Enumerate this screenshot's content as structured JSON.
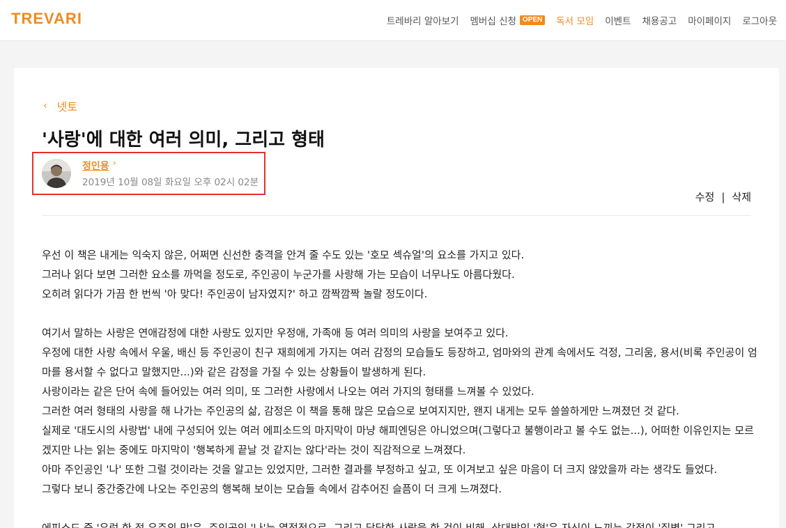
{
  "header": {
    "logo": "TREVARI",
    "nav": [
      {
        "label": "트레바리 알아보기"
      },
      {
        "label": "멤버십 신청",
        "badge": "OPEN"
      },
      {
        "label": "독서 모임",
        "active": true
      },
      {
        "label": "이벤트"
      },
      {
        "label": "채용공고"
      },
      {
        "label": "마이페이지"
      },
      {
        "label": "로그아웃"
      }
    ]
  },
  "post": {
    "back_label": "넷토",
    "title": "'사랑'에 대한 여러 의미, 그리고 형태",
    "author": "정인용",
    "date": "2019년 10월 08일 화요일 오후 02시 02분",
    "edit_label": "수정",
    "separator": "|",
    "delete_label": "삭제",
    "body": [
      "우선 이 책은 내게는 익숙지 않은, 어쩌면 신선한 충격을 안겨 줄 수도 있는 '호모 섹슈얼'의 요소를 가지고 있다.",
      "그러나 읽다 보면 그러한 요소를 까먹을 정도로, 주인공이 누군가를 사랑해 가는 모습이 너무나도 아름다웠다.",
      "오히려 읽다가 가끔 한 번씩 '아 맞다! 주인공이 남자였지?' 하고 깜짝깜짝 놀랄 정도이다.",
      "",
      "여기서 말하는 사랑은 연애감정에 대한 사랑도 있지만 우정애, 가족애 등 여러 의미의 사랑을 보여주고 있다.",
      "우정에 대한 사랑 속에서 우울, 배신 등 주인공이 친구 재희에게 가지는 여러 감정의 모습들도 등장하고, 엄마와의 관계 속에서도 걱정, 그리움, 용서(비록 주인공이 엄마를 용서할 수 없다고 말했지만...)와 같은 감정을 가질 수 있는 상황들이 발생하게 된다.",
      "사랑이라는 같은 단어 속에 들어있는 여러 의미, 또 그러한 사랑에서 나오는 여러 가지의 형태를 느껴볼 수 있었다.",
      "그러한 여러 형태의 사랑을 해 나가는 주인공의 삶, 감정은 이 책을 통해 많은 모습으로 보여지지만, 왠지 내게는 모두 쓸쓸하게만 느껴졌던 것 같다.",
      "실제로 '대도시의 사랑법' 내에 구성되어 있는 여러 에피소드의 마지막이 마냥 해피엔딩은 아니었으며(그렇다고 불행이라고 볼 수도 없는...), 어떠한 이유인지는 모르겠지만 나는 읽는 중에도 마지막이 '행복하게 끝날 것 같지는 않다'라는 것이 직감적으로 느껴졌다.",
      "아마 주인공인 '나' 또한 그럴 것이라는 것을 알고는 있었지만, 그러한 결과를 부정하고 싶고, 또 이겨보고 싶은 마음이 더 크지 않았을까 라는 생각도 들었다.",
      "그렇다 보니 중간중간에 나오는 주인공의 행복해 보이는 모습들 속에서 감추어진 슬픔이 더 크게 느껴졌다.",
      "",
      "에피소드 중 '우럭 한 점 우주의 맛'은, 주인공인 '나'는 열정적으로, 그리고 담담한 사랑을 한 것이 비해, 상대방인 '형'은 자신이 느끼는 감정이 '질병' 그리고"
    ]
  }
}
